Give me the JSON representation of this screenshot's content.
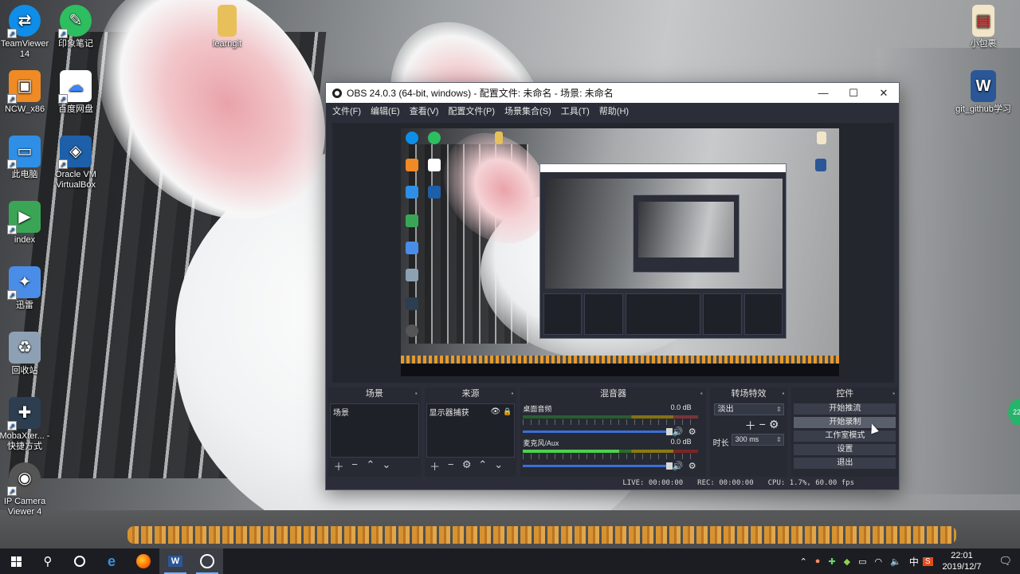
{
  "desktop": {
    "icons": [
      {
        "label": "TeamViewer 14",
        "color": "#0e8ee9",
        "glyph": "⇄"
      },
      {
        "label": "印象笔记",
        "color": "#2dbe60",
        "glyph": "🐘"
      },
      {
        "label": "learngit",
        "color": "#e8c05a",
        "glyph": "▮"
      },
      {
        "label": "NCW_x86",
        "color": "#f08a24",
        "glyph": "▣"
      },
      {
        "label": "百度网盘",
        "color": "#3a86ff",
        "glyph": "☁"
      },
      {
        "label": "此电脑",
        "color": "#2f8fe6",
        "glyph": "🖥"
      },
      {
        "label": "Oracle VM VirtualBox",
        "color": "#1d5fa8",
        "glyph": "◈"
      },
      {
        "label": "index",
        "color": "#3aa655",
        "glyph": "▶"
      },
      {
        "label": "迅雷",
        "color": "#4a8de8",
        "glyph": "✦"
      },
      {
        "label": "回收站",
        "color": "#8ea0b3",
        "glyph": "🗑"
      },
      {
        "label": "MobaXter... - 快捷方式",
        "color": "#2c3e50",
        "glyph": "✚"
      },
      {
        "label": "IP Camera Viewer 4",
        "color": "#555555",
        "glyph": "◉"
      },
      {
        "label": "小包裹",
        "color": "#d83b3b",
        "glyph": "▤"
      },
      {
        "label": "git_github学习",
        "color": "#2b5797",
        "glyph": "W"
      }
    ]
  },
  "obs": {
    "title": "OBS 24.0.3 (64-bit, windows) - 配置文件: 未命名 - 场景: 未命名",
    "window_controls": {
      "minimize": "—",
      "maximize": "☐",
      "close": "✕"
    },
    "menu": [
      "文件(F)",
      "编辑(E)",
      "查看(V)",
      "配置文件(P)",
      "场景集合(S)",
      "工具(T)",
      "帮助(H)"
    ],
    "docks": {
      "scenes": {
        "title": "场景",
        "items": [
          "场景"
        ]
      },
      "sources": {
        "title": "来源",
        "items": [
          "显示器捕获"
        ]
      },
      "mixer": {
        "title": "混音器",
        "channels": [
          {
            "name": "桌面音频",
            "level": "0.0 dB"
          },
          {
            "name": "麦克风/Aux",
            "level": "0.0 dB"
          }
        ]
      },
      "transitions": {
        "title": "转场特效",
        "selected": "淡出",
        "duration_label": "时长",
        "duration_value": "300 ms"
      },
      "controls": {
        "title": "控件",
        "buttons": [
          "开始推流",
          "开始录制",
          "工作室模式",
          "设置",
          "退出"
        ]
      }
    },
    "status": {
      "live": "LIVE: 00:00:00",
      "rec": "REC: 00:00:00",
      "cpu": "CPU: 1.7%, 60.00 fps"
    }
  },
  "taskbar": {
    "clock_time": "22:01",
    "clock_date": "2019/12/7",
    "side_badge": "22"
  }
}
